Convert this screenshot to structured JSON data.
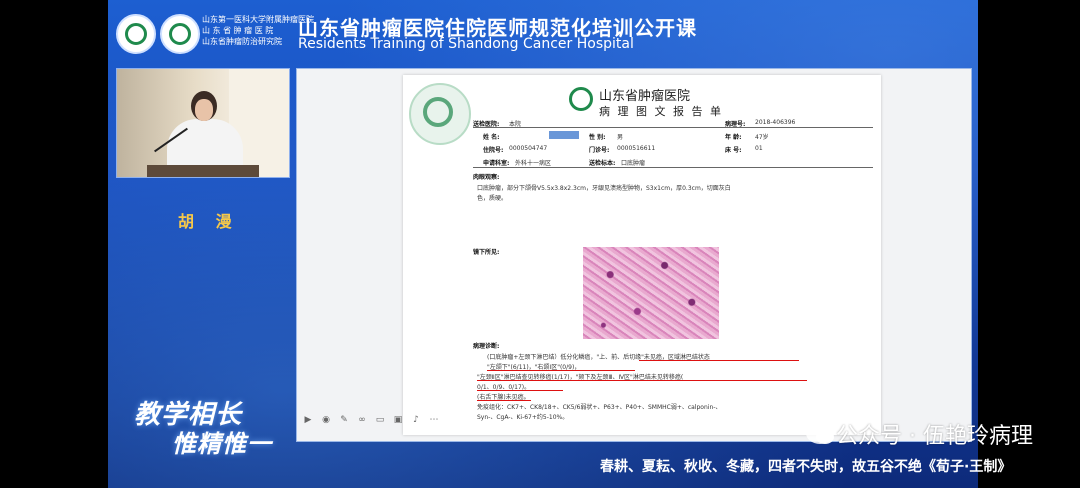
{
  "header": {
    "org_lines": [
      "山东第一医科大学附属肿瘤医院",
      "山 东 省 肿 瘤 医 院",
      "山东省肿瘤防治研究院"
    ],
    "title_cn": "山东省肿瘤医院住院医师规范化培训公开课",
    "title_en": "Residents Training of Shandong Cancer Hospital"
  },
  "speaker": {
    "name": "胡 漫"
  },
  "slogan": {
    "line1": "教学相长",
    "line2": "惟精惟一"
  },
  "report": {
    "hospital": "山东省肿瘤医院",
    "title": "病 理 图 文 报 告 单",
    "send_hospital_label": "送检医院:",
    "send_hospital": "本院",
    "pathology_no_label": "病理号:",
    "pathology_no": "2018-406396",
    "name_label": "姓 名:",
    "sex_label": "性 别:",
    "sex": "男",
    "age_label": "年 龄:",
    "age": "47岁",
    "inpatient_no_label": "住院号:",
    "inpatient_no": "0000504747",
    "clinic_no_label": "门诊号:",
    "clinic_no": "0000516611",
    "bed_label": "床 号:",
    "bed": "01",
    "dept_label": "申请科室:",
    "dept": "外科十一病区",
    "specimen_label": "送检标本:",
    "specimen": "口底肿瘤",
    "gross_label": "肉眼观察:",
    "gross_text_1": "口底肿瘤，部分下颌骨V5.5x3.8x2.3cm，牙龈见溃疡型肿物，S3x1cm，厚0.3cm，切面灰白",
    "gross_text_2": "色，质硬。",
    "micro_label": "镜下所见:",
    "diag_label": "病理诊断:",
    "diag_lines": [
      "(口底肿瘤+左颈下淋巴结）低分化鳞癌，\"上、前、后切缘\"未见癌，区域淋巴结状态",
      "\"左颌下\"(6/11)，\"右颌Ⅰ区\"(0/9)，",
      "\"左颈Ⅱ区\"淋巴结查见转移癌(1/17)，\"颏下及左颈Ⅲ、Ⅳ区\"淋巴结未见转移癌(",
      "0/1、0/9、0/17)。",
      "(右舌下腺)未见癌。",
      "免疫组化：CK7+、CK8/18+、CK5/6弱状+、P63+、P40+、SMMHC弱+、calponin-、",
      "Syn-、CgA-、Ki-67+约5-10%。"
    ]
  },
  "watermark": {
    "text": "公众号 · 伍艳玲病理"
  },
  "caption": {
    "text": "春耕、夏耘、秋收、冬藏，四者不失时，故五谷不绝《荀子·王制》"
  },
  "toolbar": {
    "icons": [
      "play-icon",
      "eye-icon",
      "pen-icon",
      "link-icon",
      "comment-icon",
      "image-icon",
      "audio-icon",
      "dots-icon"
    ]
  }
}
